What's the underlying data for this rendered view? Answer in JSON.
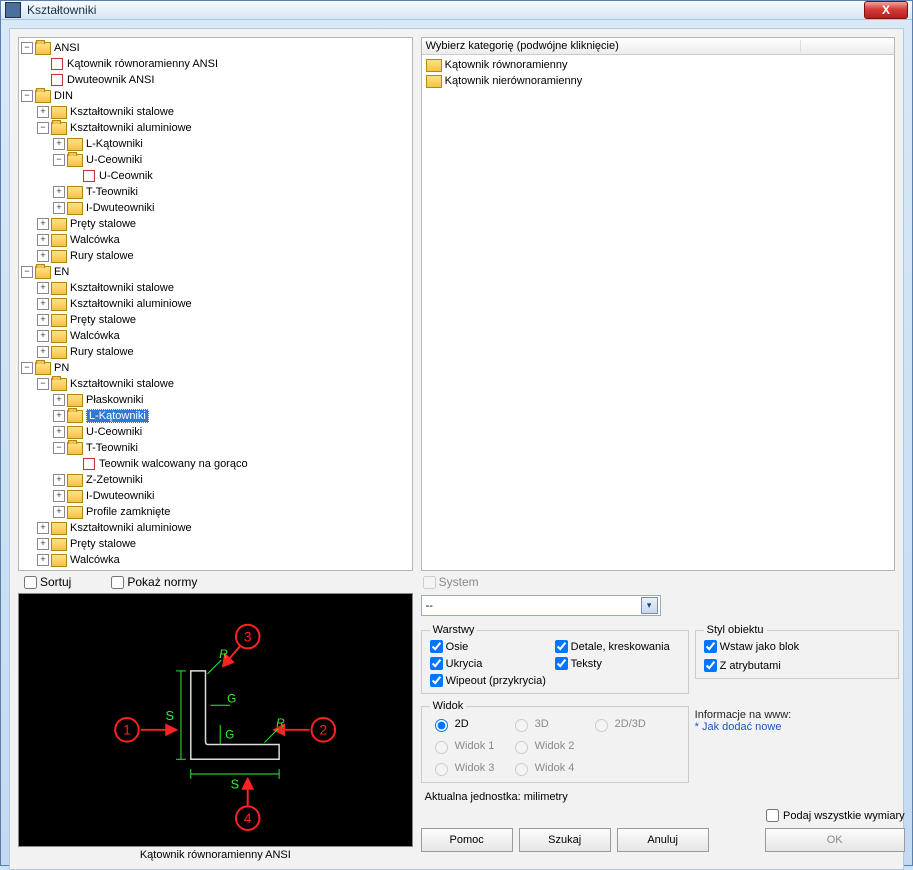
{
  "window": {
    "title": "Kształtowniki",
    "close_glyph": "X"
  },
  "tree": [
    {
      "d": 0,
      "exp": "-",
      "icon": "fo",
      "t": "ANSI"
    },
    {
      "d": 1,
      "exp": "",
      "icon": "leaf",
      "t": "Kątownik równoramienny ANSI"
    },
    {
      "d": 1,
      "exp": "",
      "icon": "leaf",
      "t": "Dwuteownik ANSI"
    },
    {
      "d": 0,
      "exp": "-",
      "icon": "fo",
      "t": "DIN"
    },
    {
      "d": 1,
      "exp": "+",
      "icon": "f",
      "t": "Kształtowniki stalowe"
    },
    {
      "d": 1,
      "exp": "-",
      "icon": "fo",
      "t": "Kształtowniki aluminiowe"
    },
    {
      "d": 2,
      "exp": "+",
      "icon": "f",
      "t": "L-Kątowniki"
    },
    {
      "d": 2,
      "exp": "-",
      "icon": "fo",
      "t": "U-Ceowniki"
    },
    {
      "d": 3,
      "exp": "",
      "icon": "leaf",
      "t": "U-Ceownik"
    },
    {
      "d": 2,
      "exp": "+",
      "icon": "f",
      "t": "T-Teowniki"
    },
    {
      "d": 2,
      "exp": "+",
      "icon": "f",
      "t": "I-Dwuteowniki"
    },
    {
      "d": 1,
      "exp": "+",
      "icon": "f",
      "t": "Pręty stalowe"
    },
    {
      "d": 1,
      "exp": "+",
      "icon": "f",
      "t": "Walcówka"
    },
    {
      "d": 1,
      "exp": "+",
      "icon": "f",
      "t": "Rury stalowe"
    },
    {
      "d": 0,
      "exp": "-",
      "icon": "fo",
      "t": "EN"
    },
    {
      "d": 1,
      "exp": "+",
      "icon": "f",
      "t": "Kształtowniki stalowe"
    },
    {
      "d": 1,
      "exp": "+",
      "icon": "f",
      "t": "Kształtowniki aluminiowe"
    },
    {
      "d": 1,
      "exp": "+",
      "icon": "f",
      "t": "Pręty stalowe"
    },
    {
      "d": 1,
      "exp": "+",
      "icon": "f",
      "t": "Walcówka"
    },
    {
      "d": 1,
      "exp": "+",
      "icon": "f",
      "t": "Rury stalowe"
    },
    {
      "d": 0,
      "exp": "-",
      "icon": "fo",
      "t": "PN"
    },
    {
      "d": 1,
      "exp": "-",
      "icon": "fo",
      "t": "Kształtowniki stalowe"
    },
    {
      "d": 2,
      "exp": "+",
      "icon": "f",
      "t": "Płaskowniki"
    },
    {
      "d": 2,
      "exp": "+",
      "icon": "fo",
      "t": "L-Kątowniki",
      "sel": true
    },
    {
      "d": 2,
      "exp": "+",
      "icon": "f",
      "t": "U-Ceowniki"
    },
    {
      "d": 2,
      "exp": "-",
      "icon": "fo",
      "t": "T-Teowniki"
    },
    {
      "d": 3,
      "exp": "",
      "icon": "leaf",
      "t": "Teownik walcowany na gorąco"
    },
    {
      "d": 2,
      "exp": "+",
      "icon": "f",
      "t": "Z-Zetowniki"
    },
    {
      "d": 2,
      "exp": "+",
      "icon": "f",
      "t": "I-Dwuteowniki"
    },
    {
      "d": 2,
      "exp": "+",
      "icon": "f",
      "t": "Profile zamknięte"
    },
    {
      "d": 1,
      "exp": "+",
      "icon": "f",
      "t": "Kształtowniki aluminiowe"
    },
    {
      "d": 1,
      "exp": "+",
      "icon": "f",
      "t": "Pręty stalowe"
    },
    {
      "d": 1,
      "exp": "+",
      "icon": "f",
      "t": "Walcówka"
    }
  ],
  "list": {
    "header": "Wybierz kategorię (podwójne kliknięcie)",
    "items": [
      "Kątownik równoramienny",
      "Kątownik nierównoramienny"
    ]
  },
  "mid": {
    "sort": "Sortuj",
    "show_norms": "Pokaż normy",
    "system": "System"
  },
  "preview": {
    "caption": "Kątownik równoramienny ANSI"
  },
  "config": {
    "combo_value": "--",
    "layers_legend": "Warstwy",
    "layers": {
      "osie": "Osie",
      "detale": "Detale, kreskowania",
      "ukrycia": "Ukrycia",
      "teksty": "Teksty",
      "wipeout": "Wipeout (przykrycia)"
    },
    "view_legend": "Widok",
    "views": {
      "v2d": "2D",
      "v3d": "3D",
      "v2d3d": "2D/3D",
      "w1": "Widok 1",
      "w2": "Widok 2",
      "w3": "Widok 3",
      "w4": "Widok 4"
    },
    "style_legend": "Styl obiektu",
    "style": {
      "blok": "Wstaw jako blok",
      "atr": "Z atrybutami"
    },
    "info_title": "Informacje na www:",
    "info_link": "* Jak dodać nowe",
    "unit": "Aktualna jednostka: milimetry",
    "podaj": "Podaj wszystkie wymiary",
    "buttons": {
      "pomoc": "Pomoc",
      "szukaj": "Szukaj",
      "anuluj": "Anuluj",
      "ok": "OK"
    }
  },
  "diagram": {
    "labels": [
      "1",
      "2",
      "3",
      "4"
    ],
    "dims": [
      "S",
      "S",
      "G",
      "G",
      "R",
      "R"
    ]
  }
}
